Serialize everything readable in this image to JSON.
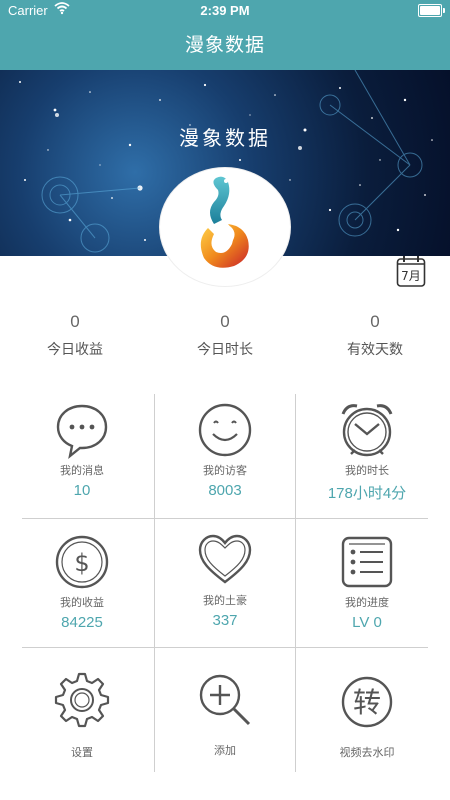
{
  "status_bar": {
    "carrier": "Carrier",
    "time": "2:39 PM"
  },
  "nav": {
    "title": "漫象数据"
  },
  "banner": {
    "title": "漫象数据"
  },
  "calendar": {
    "label": "7月"
  },
  "stats": [
    {
      "value": "0",
      "label": "今日收益"
    },
    {
      "value": "0",
      "label": "今日时长"
    },
    {
      "value": "0",
      "label": "有效天数"
    }
  ],
  "grid": [
    {
      "label": "我的消息",
      "value": "10",
      "icon": "message-icon"
    },
    {
      "label": "我的访客",
      "value": "8003",
      "icon": "smiley-icon"
    },
    {
      "label": "我的时长",
      "value": "178小时4分",
      "icon": "alarm-clock-icon"
    },
    {
      "label": "我的收益",
      "value": "84225",
      "icon": "dollar-icon"
    },
    {
      "label": "我的土豪",
      "value": "337",
      "icon": "heart-icon"
    },
    {
      "label": "我的进度",
      "value": "LV 0",
      "icon": "checklist-icon"
    },
    {
      "label": "设置",
      "value": "",
      "icon": "gear-icon"
    },
    {
      "label": "添加",
      "value": "",
      "icon": "zoom-in-icon"
    },
    {
      "label": "视频去水印",
      "value": "",
      "icon": "convert-icon",
      "icon_glyph": "转"
    }
  ],
  "colors": {
    "accent": "#4ea6ae",
    "banner_dark": "#0a1d3c",
    "line": "#cfcfcf"
  }
}
